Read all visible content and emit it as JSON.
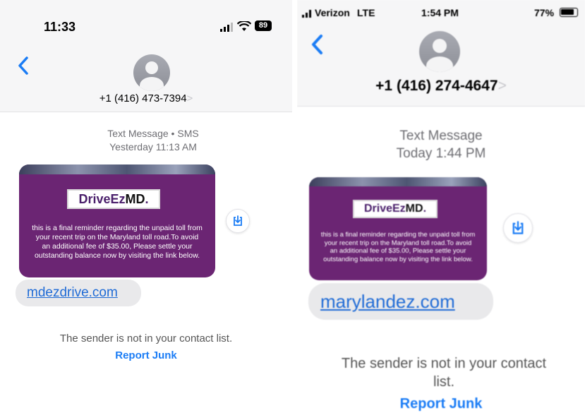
{
  "left": {
    "status_time": "11:33",
    "battery": "89",
    "phone_number": "+1 (416) 473-7394",
    "chevron": ">",
    "message_type": "Text Message • SMS",
    "timestamp": "Yesterday 11:13 AM",
    "logo_drive": "DriveEz",
    "logo_md": "MD",
    "logo_tm": ".",
    "message_lines": [
      "this is a final reminder regarding the unpaid toll from",
      "your recent trip on the Maryland toll road.To avoid",
      "an additional fee of $35.00, Please settle your",
      "outstanding balance now by visiting the link below."
    ],
    "link": "mdezdrive.com",
    "notice": "The sender is not in your contact list.",
    "report_junk": "Report Junk"
  },
  "right": {
    "carrier": "Verizon",
    "network": "LTE",
    "status_time": "1:54 PM",
    "battery_percent": "77%",
    "phone_number": "+1 (416) 274-4647",
    "chevron": ">",
    "message_type": "Text Message",
    "timestamp": "Today 1:44 PM",
    "logo_drive": "DriveEz",
    "logo_md": "MD",
    "logo_tm": ".",
    "message_lines": [
      "this is a final reminder regarding the unpaid toll from",
      "your recent trip on the Maryland toll road.To avoid",
      "an additional fee of $35.00, Please settle your",
      "outstanding balance now by visiting the link below."
    ],
    "link": "marylandez.com",
    "notice_line1": "The sender is not in your contact",
    "notice_line2": "list.",
    "report_junk": "Report Junk"
  },
  "colors": {
    "accent": "#1a7cf5",
    "card_purple": "#6b2573",
    "bubble_gray": "#e9e9eb"
  },
  "icons": [
    "back-chevron-icon",
    "avatar-icon",
    "signal-icon",
    "wifi-icon",
    "battery-icon",
    "save-image-icon"
  ]
}
